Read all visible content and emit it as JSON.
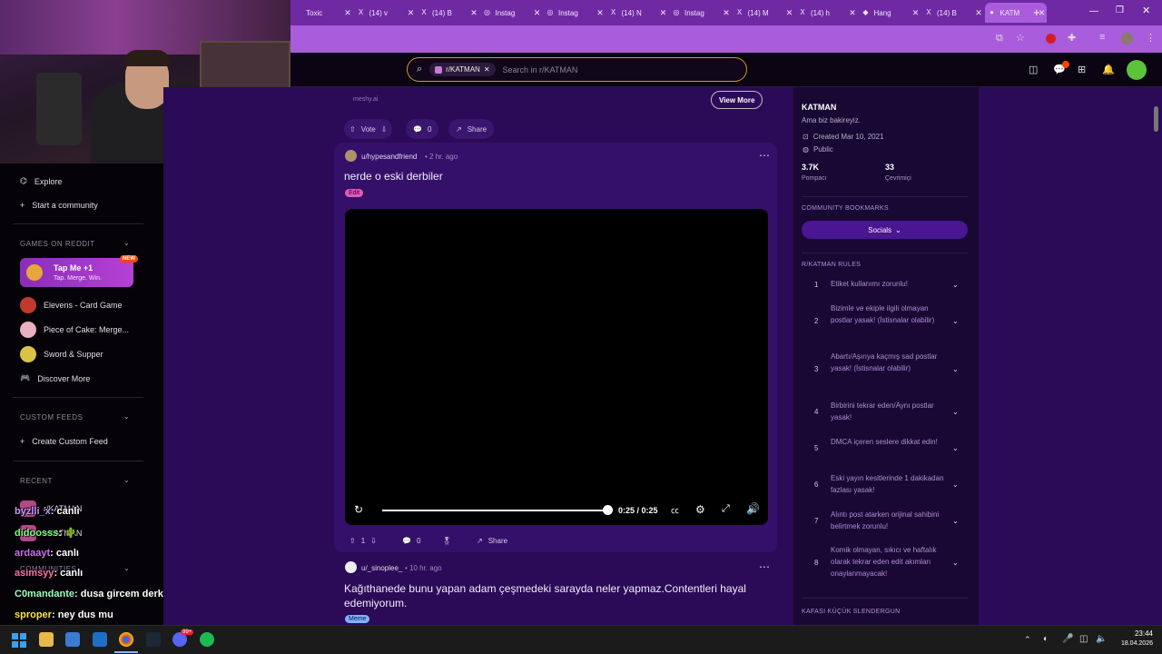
{
  "tabs": [
    {
      "label": "Toxic",
      "icon": ""
    },
    {
      "label": "(14) v",
      "icon": "X"
    },
    {
      "label": "(14) B",
      "icon": "X"
    },
    {
      "label": "Instag",
      "icon": "◎"
    },
    {
      "label": "Instag",
      "icon": "◎"
    },
    {
      "label": "(14) N",
      "icon": "X"
    },
    {
      "label": "Instag",
      "icon": "◎"
    },
    {
      "label": "(14) M",
      "icon": "X"
    },
    {
      "label": "(14) h",
      "icon": "X"
    },
    {
      "label": "Hang",
      "icon": "◆"
    },
    {
      "label": "(14) B",
      "icon": "X"
    },
    {
      "label": "KATM",
      "icon": "●"
    }
  ],
  "new_tab": "+",
  "search": {
    "chip": "r/KATMAN",
    "placeholder": "Search in r/KATMAN"
  },
  "sidebar": {
    "explore": "Explore",
    "start_community": "Start a community",
    "games_header": "GAMES ON REDDIT",
    "promo_title": "Tap Me +1",
    "promo_sub": "Tap. Merge. Win.",
    "promo_badge": "NEW",
    "games": [
      "Elevens - Card Game",
      "Piece of Cake: Merge...",
      "Sword & Supper",
      "Discover More"
    ],
    "custom_header": "CUSTOM FEEDS",
    "create_feed": "Create Custom Feed",
    "recent_header": "RECENT",
    "recent_items": [
      "r/KATMAN",
      "r/KATMAN"
    ],
    "communities_header": "COMMUNITIES"
  },
  "chat": [
    {
      "user": "byzlli_x",
      "msg": ": canlı",
      "color": "#c792ff"
    },
    {
      "user": "didoosss",
      "msg": ": 🌵",
      "color": "#7cfc7c"
    },
    {
      "user": "ardaayt",
      "msg": ": canlı",
      "color": "#d06bff"
    },
    {
      "user": "asimsyy",
      "msg": ": canlı",
      "color": "#ff6fae"
    },
    {
      "user": "C0mandante",
      "msg": ": dusa gircem derken",
      "color": "#9cffc2"
    },
    {
      "user": "sproper",
      "msg": ": ney dus mu",
      "color": "#ffe14d"
    }
  ],
  "post1": {
    "source": "meshy.ai",
    "view_more": "View More",
    "vote": "Vote",
    "comments": "0",
    "share": "Share"
  },
  "post2": {
    "author": "u/hypesandfriend",
    "time": "2 hr. ago",
    "title": "nerde o eski derbiler",
    "flair": "Edit",
    "time_label": "0:25 / 0:25",
    "progress": 1.0,
    "votes": "1",
    "comments": "0",
    "share": "Share"
  },
  "post3": {
    "author": "u/_sinoplee_",
    "time": "10 hr. ago",
    "title": "Kağıthanede bunu yapan adam çeşmedeki sarayda neler yapmaz.Contentleri hayal edemiyorum.",
    "flair": "Meme"
  },
  "community": {
    "name": "KATMAN",
    "desc": "Ama biz bakireyiz.",
    "created": "Created Mar 10, 2021",
    "visibility": "Public",
    "members": "3.7K",
    "members_label": "Pompacı",
    "online": "33",
    "online_label": "Çevrimiçi",
    "bookmarks_header": "COMMUNITY BOOKMARKS",
    "socials": "Socials",
    "rules_header": "R/KATMAN RULES",
    "rules": [
      "Etiket kullanımı zorunlu!",
      "Bizimle ve ekiple ilgili olmayan postlar yasak! (İstisnalar olabilir)",
      "Abartı/Aşırıya kaçmış sad postlar yasak! (İstisnalar olabilir)",
      "Birbirini tekrar eden/Aynı postlar yasak!",
      "DMCA içeren seslere dikkat edin!",
      "Eski yayın kesitlerinde 1 dakikadan fazlası yasak!",
      "Alıntı post atarken orijinal sahibini belirtmek zorunlu!",
      "Komik olmayan, sıkıcı ve haftalık olarak tekrar eden edit akımları onaylanmayacak!"
    ],
    "footer_header": "KAFASI KÜÇÜK SLENDERGUN"
  },
  "taskbar": {
    "time": "23:44",
    "date": "18.04.2026",
    "badge": "99+"
  },
  "colors": {
    "accent": "#a95cdc",
    "feed_bg": "#2b0a57",
    "post_bg": "#35106a",
    "search_border": "#d49a1e"
  }
}
